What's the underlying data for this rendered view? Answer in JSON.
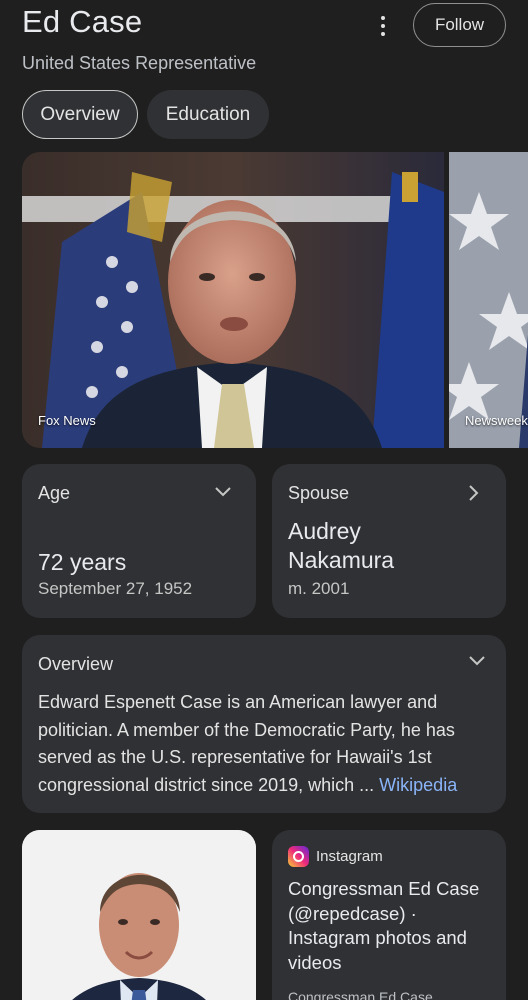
{
  "header": {
    "title": "Ed Case",
    "subtitle": "United States Representative",
    "follow_label": "Follow",
    "more_icon": "more-vert-icon"
  },
  "tabs": [
    {
      "label": "Overview",
      "active": true
    },
    {
      "label": "Education",
      "active": false
    }
  ],
  "gallery": {
    "images": [
      {
        "caption": "Fox News"
      },
      {
        "caption": "Newsweek"
      }
    ]
  },
  "age_card": {
    "label": "Age",
    "value": "72 years",
    "detail": "September 27, 1952",
    "icon": "chevron-down-icon"
  },
  "spouse_card": {
    "label": "Spouse",
    "value_line1": "Audrey",
    "value_line2": "Nakamura",
    "detail": "m. 2001",
    "icon": "chevron-right-icon"
  },
  "overview_card": {
    "label": "Overview",
    "text": "Edward Espenett Case is an American lawyer and politician. A member of the Democratic Party, he has served as the U.S. representative for Hawaii's 1st congressional district since 2019, which ... ",
    "link": "Wikipedia",
    "icon": "chevron-down-icon"
  },
  "instagram_card": {
    "source": "Instagram",
    "title": "Congressman Ed Case (@repedcase) · Instagram photos and videos",
    "snippet": "Congressman Ed Case"
  },
  "colors": {
    "background": "#1f1f1f",
    "card": "#303134",
    "link": "#8ab4f8"
  }
}
